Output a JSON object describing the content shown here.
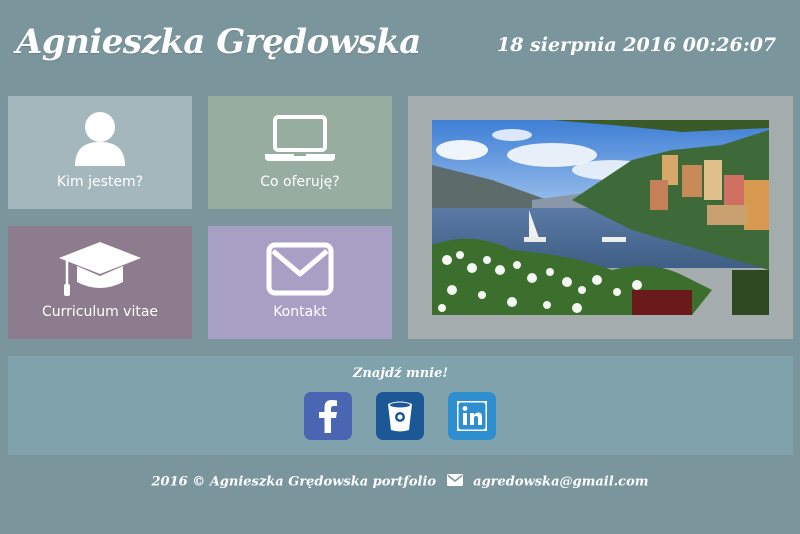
{
  "header": {
    "title": "Agnieszka Grędowska",
    "datetime": "18 sierpnia 2016 00:26:07"
  },
  "tiles": [
    {
      "label": "Kim jestem?",
      "icon": "person-icon",
      "color": "#a4b7bc"
    },
    {
      "label": "Co oferuję?",
      "icon": "laptop-icon",
      "color": "#97ad9f"
    },
    {
      "label": "Curriculum vitae",
      "icon": "graduation-cap-icon",
      "color": "#8d7b8e"
    },
    {
      "label": "Kontakt",
      "icon": "envelope-icon",
      "color": "#a8a0c4"
    }
  ],
  "social": {
    "title": "Znajdź mnie!",
    "links": [
      {
        "icon": "facebook-icon",
        "color": "#4a66b2"
      },
      {
        "icon": "bucket-icon",
        "color": "#1c5796"
      },
      {
        "icon": "linkedin-icon",
        "color": "#2e8fd0"
      }
    ]
  },
  "footer": {
    "copyright": "2016 © Agnieszka Grędowska portfolio",
    "email": "agredowska@gmail.com"
  },
  "colors": {
    "background": "#7a969c",
    "photo_frame": "#a5acad",
    "social_bar": "#7fa2ac"
  }
}
